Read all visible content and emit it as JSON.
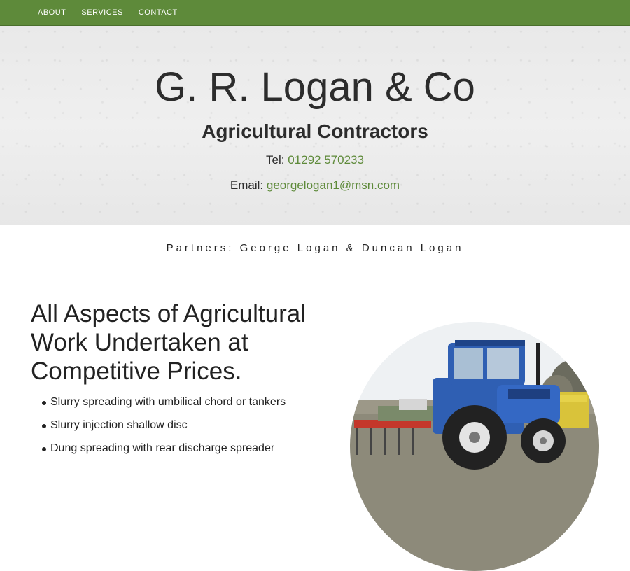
{
  "nav": {
    "items": [
      "ABOUT",
      "SERVICES",
      "CONTACT"
    ]
  },
  "hero": {
    "title": "G. R. Logan & Co",
    "subtitle": "Agricultural Contractors",
    "tel_label": "Tel:",
    "tel_value": "01292 570233",
    "email_label": "Email:",
    "email_value": "georgelogan1@msn.com"
  },
  "partners": "Partners: George Logan & Duncan Logan",
  "main": {
    "heading": "All Aspects of Agricultural Work Undertaken at Competitive Prices.",
    "services": [
      "Slurry spreading with umbilical chord or tankers",
      "Slurry injection shallow disc",
      "Dung spreading with rear discharge spreader"
    ]
  },
  "colors": {
    "nav_bg": "#5e8a3a",
    "link": "#5e8a3a",
    "tractor": "#2f5fb3"
  },
  "photo_alt_icon": "tractor-photo"
}
